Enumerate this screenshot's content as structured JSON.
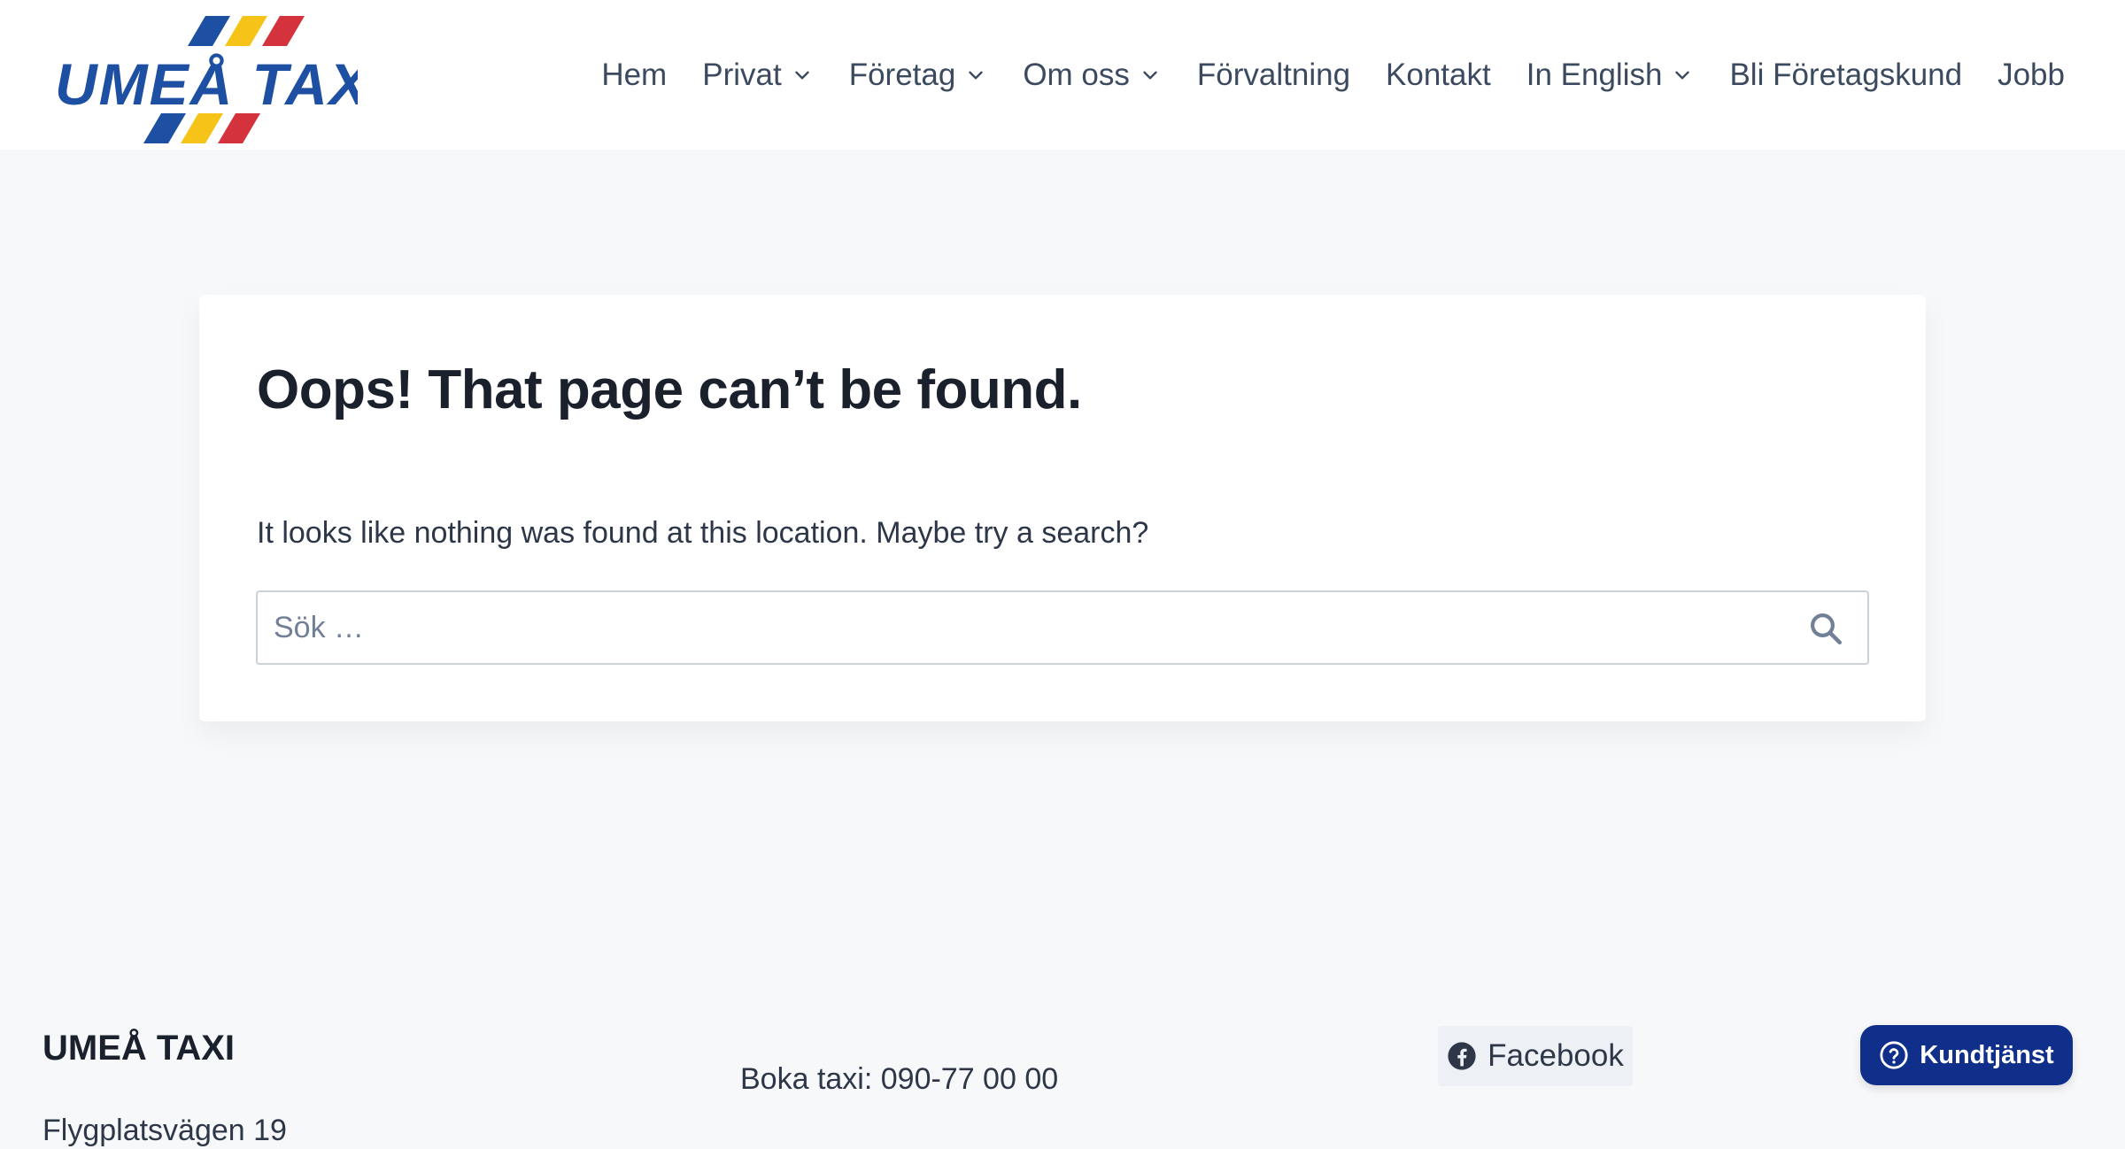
{
  "brand": {
    "logo_text": "UMEÅ TAXI",
    "colors": {
      "blue": "#1d4fa3",
      "yellow": "#f6c419",
      "red": "#d4323c"
    }
  },
  "nav": {
    "items": [
      {
        "label": "Hem",
        "has_dropdown": false
      },
      {
        "label": "Privat",
        "has_dropdown": true
      },
      {
        "label": "Företag",
        "has_dropdown": true
      },
      {
        "label": "Om oss",
        "has_dropdown": true
      },
      {
        "label": "Förvaltning",
        "has_dropdown": false
      },
      {
        "label": "Kontakt",
        "has_dropdown": false
      },
      {
        "label": "In English",
        "has_dropdown": true
      },
      {
        "label": "Bli Företagskund",
        "has_dropdown": false
      },
      {
        "label": "Jobb",
        "has_dropdown": false
      }
    ]
  },
  "main": {
    "title": "Oops! That page can’t be found.",
    "message": "It looks like nothing was found at this location. Maybe try a search?",
    "search": {
      "placeholder": "Sök …",
      "value": "",
      "icon": "search-icon"
    }
  },
  "footer": {
    "company_title": "UMEÅ TAXI",
    "address": "Flygplatsvägen 19",
    "phone_line": "Boka taxi: 090-77 00 00",
    "facebook_label": "Facebook",
    "help_label": "Kundtjänst",
    "help_color": "#0f2f8a"
  }
}
